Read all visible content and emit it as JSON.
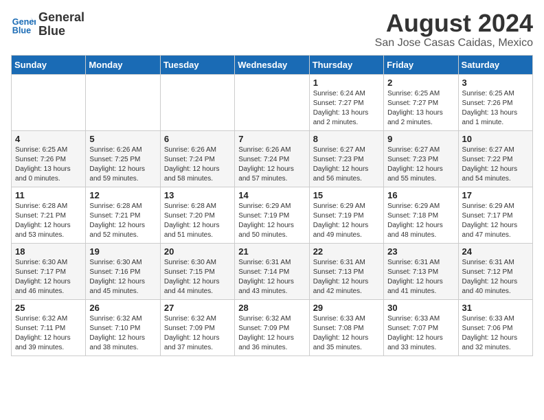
{
  "logo": {
    "line1": "General",
    "line2": "Blue"
  },
  "title": "August 2024",
  "location": "San Jose Casas Caidas, Mexico",
  "days_of_week": [
    "Sunday",
    "Monday",
    "Tuesday",
    "Wednesday",
    "Thursday",
    "Friday",
    "Saturday"
  ],
  "weeks": [
    [
      {
        "day": "",
        "info": ""
      },
      {
        "day": "",
        "info": ""
      },
      {
        "day": "",
        "info": ""
      },
      {
        "day": "",
        "info": ""
      },
      {
        "day": "1",
        "info": "Sunrise: 6:24 AM\nSunset: 7:27 PM\nDaylight: 13 hours\nand 2 minutes."
      },
      {
        "day": "2",
        "info": "Sunrise: 6:25 AM\nSunset: 7:27 PM\nDaylight: 13 hours\nand 2 minutes."
      },
      {
        "day": "3",
        "info": "Sunrise: 6:25 AM\nSunset: 7:26 PM\nDaylight: 13 hours\nand 1 minute."
      }
    ],
    [
      {
        "day": "4",
        "info": "Sunrise: 6:25 AM\nSunset: 7:26 PM\nDaylight: 13 hours\nand 0 minutes."
      },
      {
        "day": "5",
        "info": "Sunrise: 6:26 AM\nSunset: 7:25 PM\nDaylight: 12 hours\nand 59 minutes."
      },
      {
        "day": "6",
        "info": "Sunrise: 6:26 AM\nSunset: 7:24 PM\nDaylight: 12 hours\nand 58 minutes."
      },
      {
        "day": "7",
        "info": "Sunrise: 6:26 AM\nSunset: 7:24 PM\nDaylight: 12 hours\nand 57 minutes."
      },
      {
        "day": "8",
        "info": "Sunrise: 6:27 AM\nSunset: 7:23 PM\nDaylight: 12 hours\nand 56 minutes."
      },
      {
        "day": "9",
        "info": "Sunrise: 6:27 AM\nSunset: 7:23 PM\nDaylight: 12 hours\nand 55 minutes."
      },
      {
        "day": "10",
        "info": "Sunrise: 6:27 AM\nSunset: 7:22 PM\nDaylight: 12 hours\nand 54 minutes."
      }
    ],
    [
      {
        "day": "11",
        "info": "Sunrise: 6:28 AM\nSunset: 7:21 PM\nDaylight: 12 hours\nand 53 minutes."
      },
      {
        "day": "12",
        "info": "Sunrise: 6:28 AM\nSunset: 7:21 PM\nDaylight: 12 hours\nand 52 minutes."
      },
      {
        "day": "13",
        "info": "Sunrise: 6:28 AM\nSunset: 7:20 PM\nDaylight: 12 hours\nand 51 minutes."
      },
      {
        "day": "14",
        "info": "Sunrise: 6:29 AM\nSunset: 7:19 PM\nDaylight: 12 hours\nand 50 minutes."
      },
      {
        "day": "15",
        "info": "Sunrise: 6:29 AM\nSunset: 7:19 PM\nDaylight: 12 hours\nand 49 minutes."
      },
      {
        "day": "16",
        "info": "Sunrise: 6:29 AM\nSunset: 7:18 PM\nDaylight: 12 hours\nand 48 minutes."
      },
      {
        "day": "17",
        "info": "Sunrise: 6:29 AM\nSunset: 7:17 PM\nDaylight: 12 hours\nand 47 minutes."
      }
    ],
    [
      {
        "day": "18",
        "info": "Sunrise: 6:30 AM\nSunset: 7:17 PM\nDaylight: 12 hours\nand 46 minutes."
      },
      {
        "day": "19",
        "info": "Sunrise: 6:30 AM\nSunset: 7:16 PM\nDaylight: 12 hours\nand 45 minutes."
      },
      {
        "day": "20",
        "info": "Sunrise: 6:30 AM\nSunset: 7:15 PM\nDaylight: 12 hours\nand 44 minutes."
      },
      {
        "day": "21",
        "info": "Sunrise: 6:31 AM\nSunset: 7:14 PM\nDaylight: 12 hours\nand 43 minutes."
      },
      {
        "day": "22",
        "info": "Sunrise: 6:31 AM\nSunset: 7:13 PM\nDaylight: 12 hours\nand 42 minutes."
      },
      {
        "day": "23",
        "info": "Sunrise: 6:31 AM\nSunset: 7:13 PM\nDaylight: 12 hours\nand 41 minutes."
      },
      {
        "day": "24",
        "info": "Sunrise: 6:31 AM\nSunset: 7:12 PM\nDaylight: 12 hours\nand 40 minutes."
      }
    ],
    [
      {
        "day": "25",
        "info": "Sunrise: 6:32 AM\nSunset: 7:11 PM\nDaylight: 12 hours\nand 39 minutes."
      },
      {
        "day": "26",
        "info": "Sunrise: 6:32 AM\nSunset: 7:10 PM\nDaylight: 12 hours\nand 38 minutes."
      },
      {
        "day": "27",
        "info": "Sunrise: 6:32 AM\nSunset: 7:09 PM\nDaylight: 12 hours\nand 37 minutes."
      },
      {
        "day": "28",
        "info": "Sunrise: 6:32 AM\nSunset: 7:09 PM\nDaylight: 12 hours\nand 36 minutes."
      },
      {
        "day": "29",
        "info": "Sunrise: 6:33 AM\nSunset: 7:08 PM\nDaylight: 12 hours\nand 35 minutes."
      },
      {
        "day": "30",
        "info": "Sunrise: 6:33 AM\nSunset: 7:07 PM\nDaylight: 12 hours\nand 33 minutes."
      },
      {
        "day": "31",
        "info": "Sunrise: 6:33 AM\nSunset: 7:06 PM\nDaylight: 12 hours\nand 32 minutes."
      }
    ]
  ]
}
